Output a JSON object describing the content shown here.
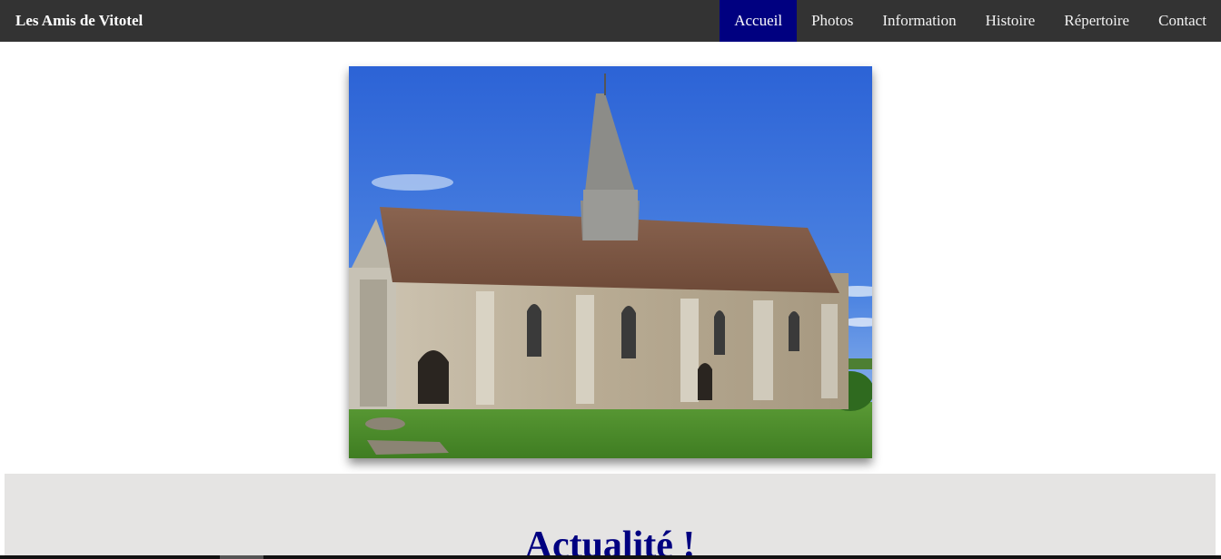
{
  "nav": {
    "brand": "Les Amis de Vitotel",
    "links": [
      {
        "label": "Accueil",
        "active": true
      },
      {
        "label": "Photos",
        "active": false
      },
      {
        "label": "Information",
        "active": false
      },
      {
        "label": "Histoire",
        "active": false
      },
      {
        "label": "Répertoire",
        "active": false
      },
      {
        "label": "Contact",
        "active": false
      }
    ]
  },
  "hero": {
    "image": "church-photo"
  },
  "news": {
    "title": "Actualité !"
  },
  "colors": {
    "nav_bg": "#333333",
    "active_bg": "#000080",
    "heading": "#000080",
    "section_bg": "#e5e4e3"
  }
}
